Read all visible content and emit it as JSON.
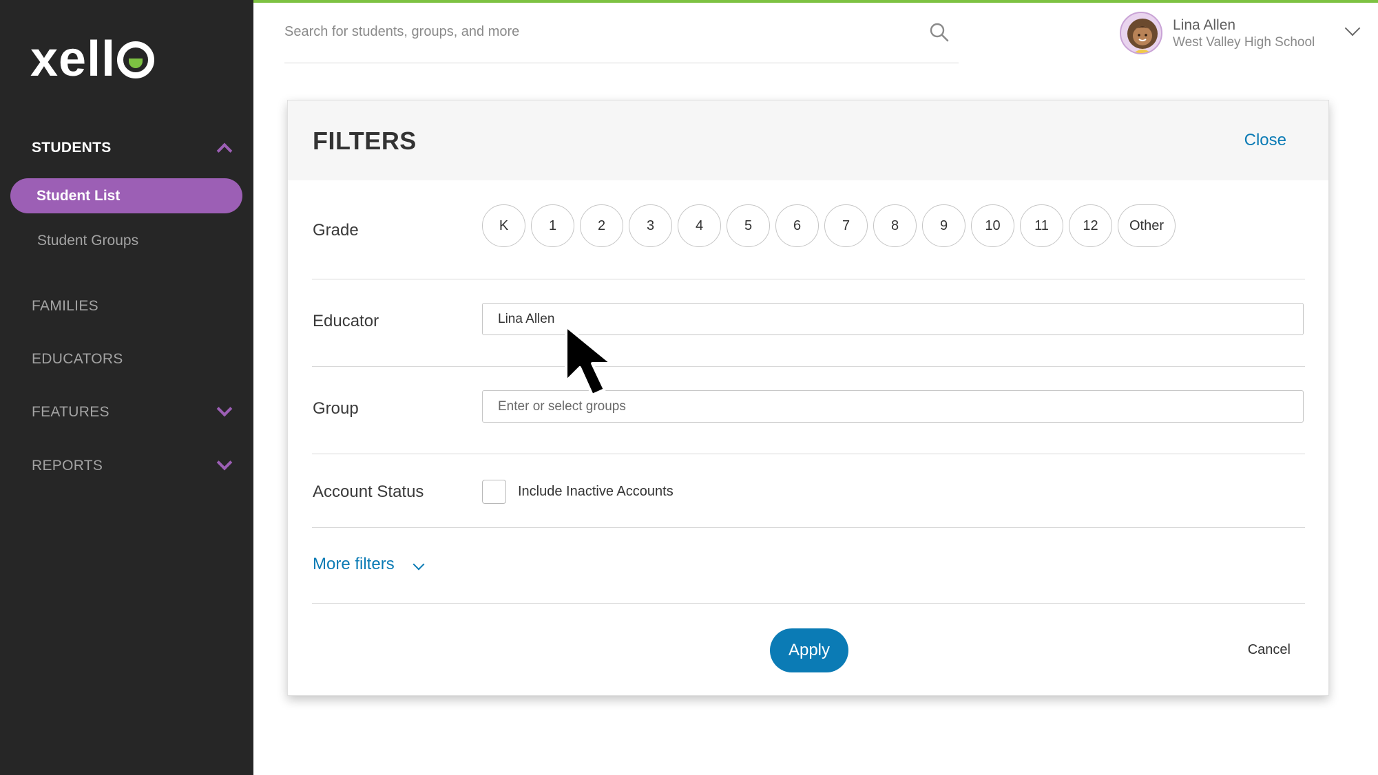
{
  "app": {
    "logo_text": "xell",
    "logo_o": "o"
  },
  "colors": {
    "accent_green": "#7dc242",
    "sidebar_bg": "#262626",
    "purple": "#9c5fb5",
    "link_blue": "#0b7bb5"
  },
  "sidebar": {
    "students_label": "STUDENTS",
    "students_chevron_icon": "chevron-up-icon",
    "student_list_label": "Student List",
    "student_groups_label": "Student Groups",
    "families_label": "FAMILIES",
    "educators_label": "EDUCATORS",
    "features_label": "FEATURES",
    "reports_label": "REPORTS"
  },
  "header": {
    "search_placeholder": "Search for students, groups, and more",
    "search_icon": "search-icon",
    "user_name": "Lina Allen",
    "user_school": "West Valley High School"
  },
  "filters": {
    "title": "FILTERS",
    "close_label": "Close",
    "grade_label": "Grade",
    "grades": [
      "K",
      "1",
      "2",
      "3",
      "4",
      "5",
      "6",
      "7",
      "8",
      "9",
      "10",
      "11",
      "12",
      "Other"
    ],
    "educator_label": "Educator",
    "educator_value": "Lina Allen",
    "group_label": "Group",
    "group_placeholder": "Enter or select groups",
    "account_status_label": "Account Status",
    "inactive_label": "Include Inactive Accounts",
    "more_filters_label": "More filters",
    "apply_label": "Apply",
    "cancel_label": "Cancel"
  }
}
